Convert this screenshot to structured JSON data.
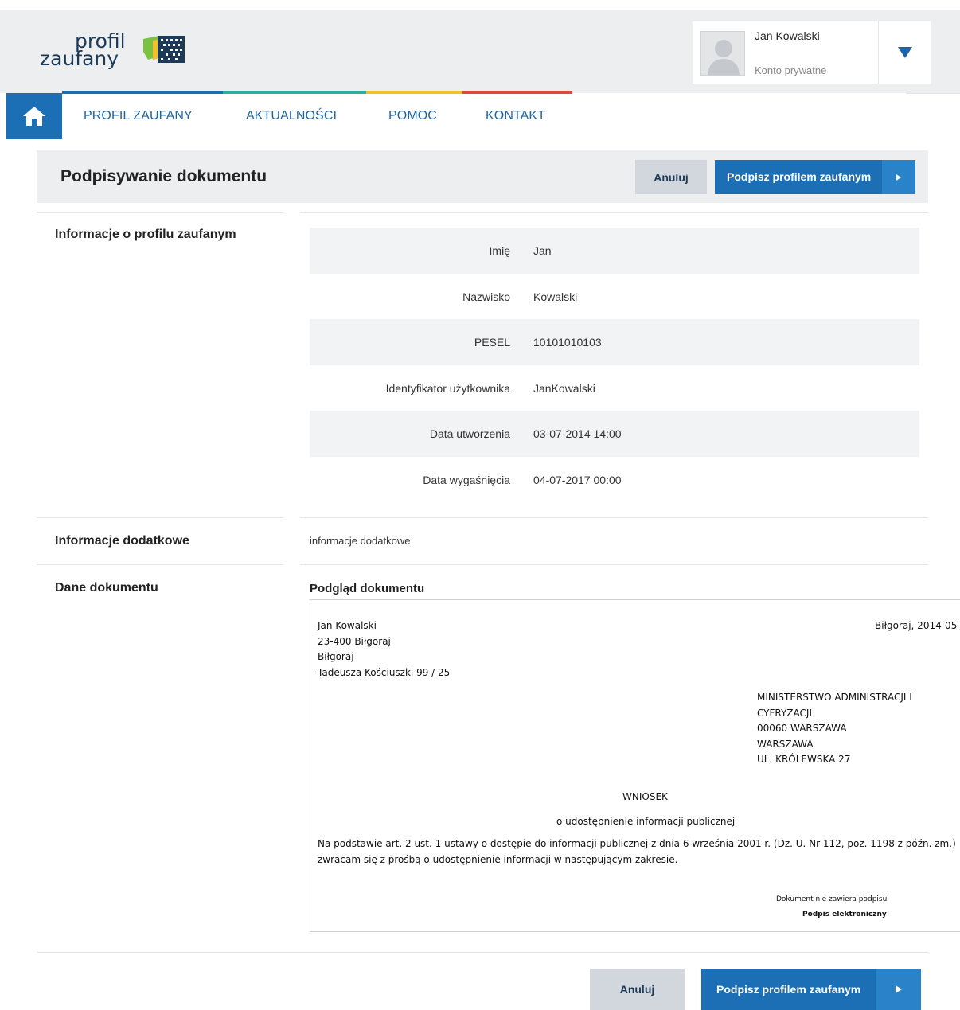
{
  "header": {
    "logo_line1": "profil",
    "logo_line2": "zaufany",
    "user_name": "Jan Kowalski",
    "user_account_type": "Konto prywatne"
  },
  "nav": {
    "items": [
      "PROFIL ZAUFANY",
      "AKTUALNOŚCI",
      "POMOC",
      "KONTAKT"
    ],
    "accent_colors": [
      "#1c6fb5",
      "#2bb0a0",
      "#f2c028",
      "#e04a3a"
    ]
  },
  "page": {
    "title": "Podpisywanie dokumentu",
    "cancel_label": "Anuluj",
    "sign_label": "Podpisz profilem zaufanym"
  },
  "profile_info": {
    "section_label": "Informacje o profilu zaufanym",
    "rows": [
      {
        "key": "Imię",
        "value": "Jan"
      },
      {
        "key": "Nazwisko",
        "value": "Kowalski"
      },
      {
        "key": "PESEL",
        "value": "10101010103"
      },
      {
        "key": "Identyfikator użytkownika",
        "value": "JanKowalski"
      },
      {
        "key": "Data utworzenia",
        "value": "03-07-2014 14:00"
      },
      {
        "key": "Data wygaśnięcia",
        "value": "04-07-2017 00:00"
      }
    ]
  },
  "extra_info": {
    "section_label": "Informacje dodatkowe",
    "value": "informacje dodatkowe"
  },
  "document": {
    "section_label": "Dane dokumentu",
    "preview_title": "Podgląd dokumentu",
    "sender_lines": [
      "Jan Kowalski",
      "23-400 Biłgoraj",
      "Biłgoraj",
      "Tadeusza Kościuszki 99 / 25"
    ],
    "place_date": "Biłgoraj, 2014-05-",
    "recipient_lines": [
      "MINISTERSTWO ADMINISTRACJI I",
      "CYFRYZACJI",
      "00060 WARSZAWA",
      "WARSZAWA",
      "UL. KRÓLEWSKA 27"
    ],
    "heading": "WNIOSEK",
    "subheading": "o udostępnienie informacji publicznej",
    "body_line1": "Na podstawie art. 2 ust. 1 ustawy o dostępie do informacji publicznej z dnia 6 września 2001 r. (Dz. U. Nr 112, poz. 1198 z późn. zm.)",
    "body_line2": "zwracam się z prośbą o udostępnienie informacji w następującym zakresie.",
    "no_signature": "Dokument nie zawiera podpisu",
    "signature_label": "Podpis elektroniczny"
  },
  "footer": {
    "cancel_label": "Anuluj",
    "sign_label": "Podpisz profilem zaufanym"
  }
}
